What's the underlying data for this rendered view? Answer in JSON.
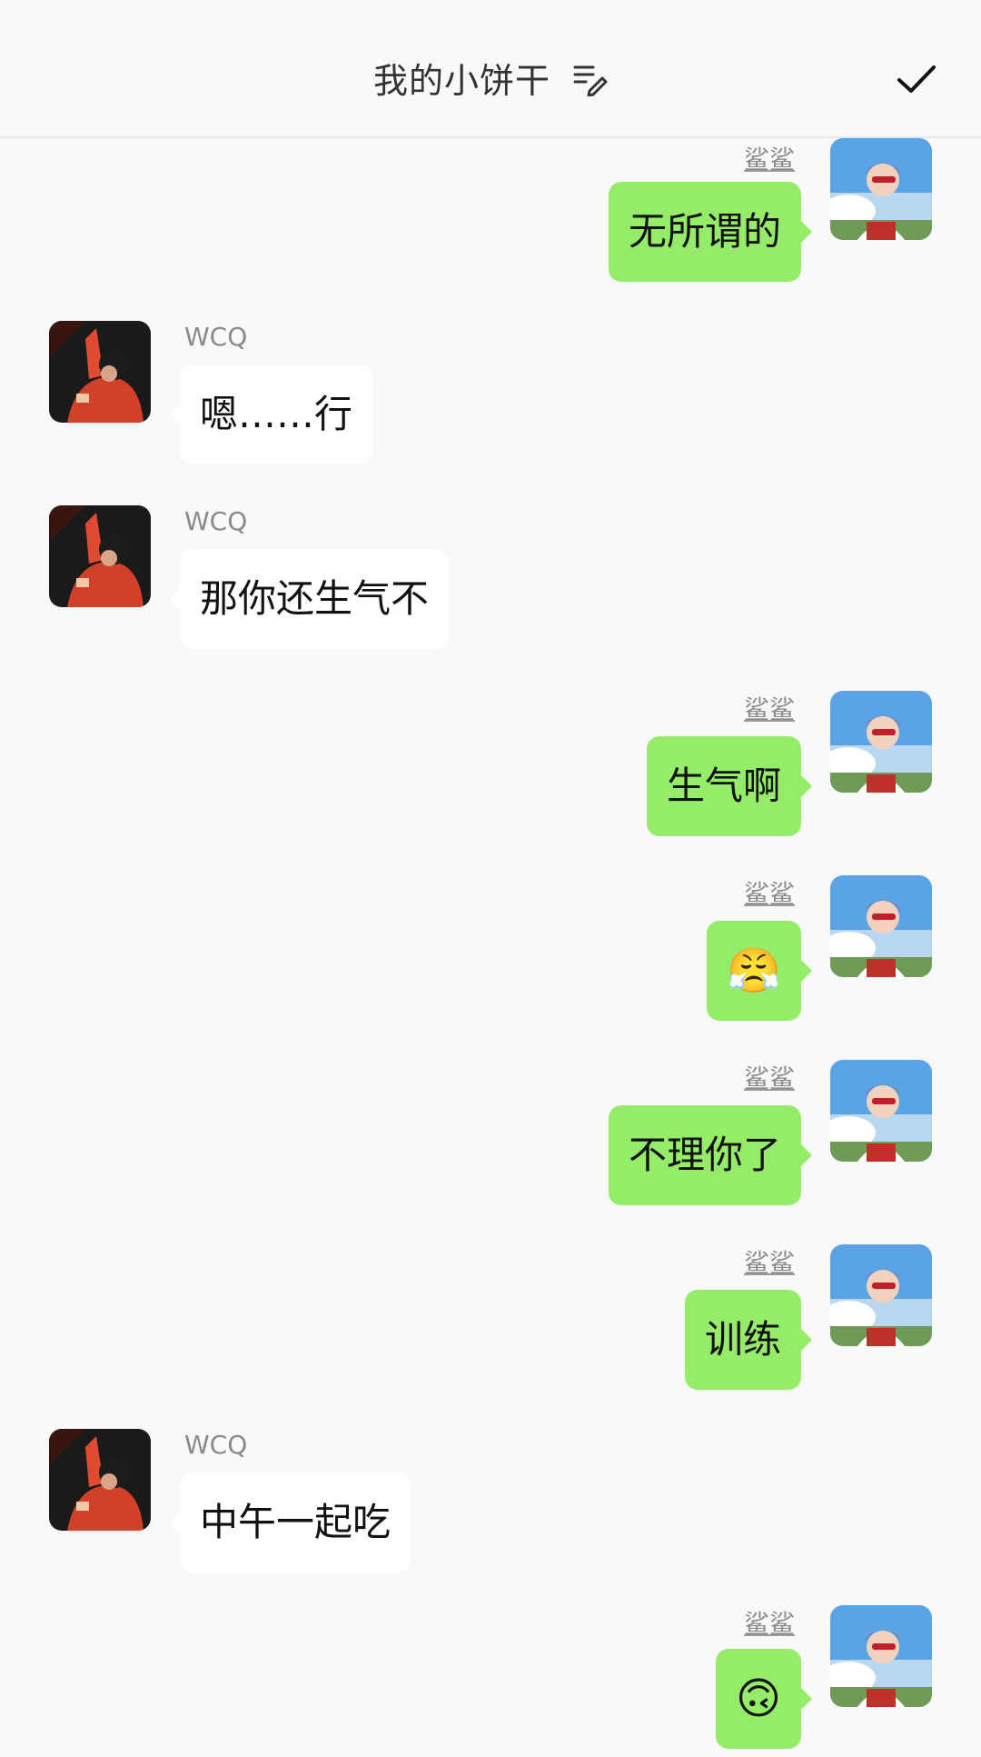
{
  "header": {
    "title": "我的小饼干"
  },
  "colors": {
    "background": "#f9f9f9",
    "self_bubble": "#95ec69",
    "other_bubble": "#ffffff"
  },
  "messages": [
    {
      "side": "right",
      "sender": "鲨鲨",
      "text": "无所谓的"
    },
    {
      "side": "left",
      "sender": "WCQ",
      "text": "嗯……行"
    },
    {
      "side": "left",
      "sender": "WCQ",
      "text": "那你还生气不"
    },
    {
      "side": "right",
      "sender": "鲨鲨",
      "text": "生气啊"
    },
    {
      "side": "right",
      "sender": "鲨鲨",
      "text": "😤"
    },
    {
      "side": "right",
      "sender": "鲨鲨",
      "text": "不理你了"
    },
    {
      "side": "right",
      "sender": "鲨鲨",
      "text": "训练"
    },
    {
      "side": "left",
      "sender": "WCQ",
      "text": "中午一起吃"
    },
    {
      "side": "right",
      "sender": "鲨鲨",
      "text": "🙃"
    }
  ]
}
